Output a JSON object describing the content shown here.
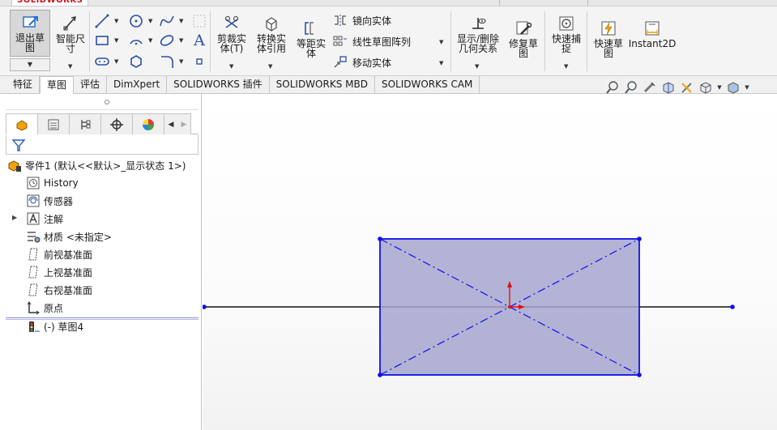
{
  "app": {
    "logo_text": "SOLIDWORKS"
  },
  "ribbon": {
    "exit_sketch": "退出草\n图",
    "smart_dimension": "智能尺\n寸",
    "trim": "剪裁实\n体(T)",
    "convert": "转换实\n体引用",
    "offset": "等距实\n体",
    "mirror": "镜向实体",
    "linear_pattern": "线性草图阵列",
    "move": "移动实体",
    "show_delete_relations": "显示/删除\n几何关系",
    "repair_sketch": "修复草\n图",
    "quick_snaps": "快速捕\n捉",
    "rapid_sketch": "快速草\n图",
    "instant2d": "Instant2D",
    "text_tool_glyph": "A"
  },
  "tabs": [
    {
      "label": "特征",
      "active": false
    },
    {
      "label": "草图",
      "active": true
    },
    {
      "label": "评估",
      "active": false
    },
    {
      "label": "DimXpert",
      "active": false
    },
    {
      "label": "SOLIDWORKS 插件",
      "active": false
    },
    {
      "label": "SOLIDWORKS MBD",
      "active": false
    },
    {
      "label": "SOLIDWORKS CAM",
      "active": false
    }
  ],
  "feature_tree": {
    "root": "零件1  (默认<<默认>_显示状态 1>)",
    "items": [
      {
        "label": "History",
        "icon": "history-icon"
      },
      {
        "label": "传感器",
        "icon": "sensor-icon"
      },
      {
        "label": "注解",
        "icon": "annotation-icon",
        "expandable": true
      },
      {
        "label": "材质 <未指定>",
        "icon": "material-icon"
      },
      {
        "label": "前视基准面",
        "icon": "plane-icon"
      },
      {
        "label": "上视基准面",
        "icon": "plane-icon"
      },
      {
        "label": "右视基准面",
        "icon": "plane-icon"
      },
      {
        "label": "原点",
        "icon": "origin-icon"
      },
      {
        "label": "(-) 草图4",
        "icon": "sketch-icon"
      }
    ]
  },
  "colors": {
    "sketch_blue": "#1010e8",
    "rect_fill": "#a6a6cf",
    "origin_red": "#e01010",
    "accent_orange": "#f2a20c"
  }
}
